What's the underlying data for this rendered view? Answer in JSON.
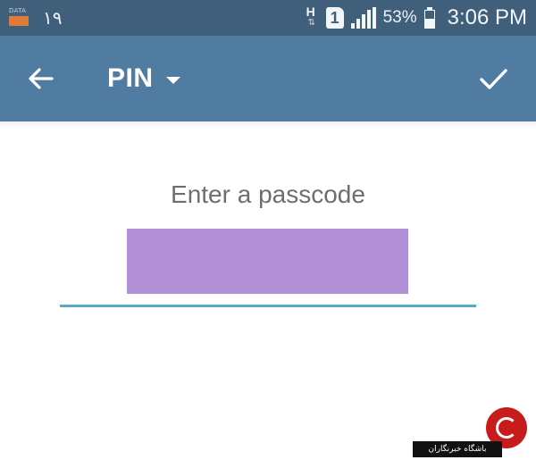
{
  "status_bar": {
    "data_label": "DATA",
    "left_number": "١٩",
    "network_type": "H",
    "sim_slot": "1",
    "battery_percent": "53%",
    "battery_level": 0.53,
    "time": "3:06 PM"
  },
  "toolbar": {
    "back_icon": "arrow-back-icon",
    "title": "PIN",
    "dropdown_icon": "caret-down-icon",
    "done_icon": "checkmark-icon"
  },
  "content": {
    "prompt": "Enter a passcode",
    "passcode_value": ""
  },
  "watermark": {
    "text": "باشگاه خبرنگاران"
  },
  "colors": {
    "status_bar_bg": "#3f5f7b",
    "toolbar_bg": "#517ca1",
    "underline": "#55aac6",
    "mask": "#b18fd6"
  }
}
